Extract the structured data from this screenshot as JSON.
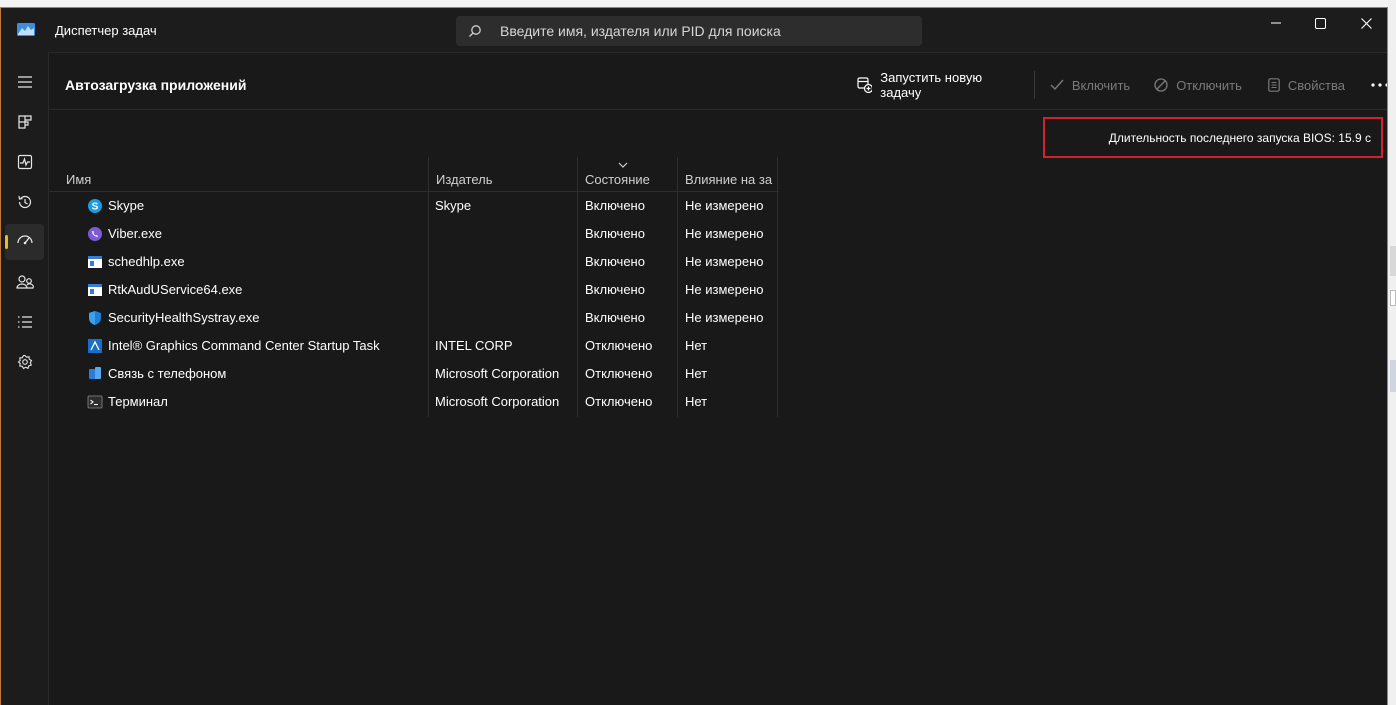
{
  "window": {
    "title": "Диспетчер задач",
    "search_placeholder": "Введите имя, издателя или PID для поиска"
  },
  "sidebar": {
    "items": [
      {
        "icon": "hamburger-menu-icon"
      },
      {
        "icon": "processes-icon"
      },
      {
        "icon": "performance-icon"
      },
      {
        "icon": "app-history-icon"
      },
      {
        "icon": "startup-apps-icon",
        "active": true
      },
      {
        "icon": "users-icon"
      },
      {
        "icon": "details-icon"
      },
      {
        "icon": "services-icon"
      }
    ]
  },
  "header": {
    "title": "Автозагрузка приложений",
    "run_task": "Запустить новую задачу",
    "enable": "Включить",
    "disable": "Отключить",
    "properties": "Свойства"
  },
  "bios": {
    "text": "Длительность последнего запуска BIOS: 15.9 с"
  },
  "table": {
    "columns": {
      "name": "Имя",
      "publisher": "Издатель",
      "status": "Состояние",
      "impact": "Влияние на за"
    },
    "rows": [
      {
        "name": "Skype",
        "publisher": "Skype",
        "status": "Включено",
        "impact": "Не измерено",
        "icon": "skype-icon"
      },
      {
        "name": "Viber.exe",
        "publisher": "",
        "status": "Включено",
        "impact": "Не измерено",
        "icon": "viber-icon"
      },
      {
        "name": "schedhlp.exe",
        "publisher": "",
        "status": "Включено",
        "impact": "Не измерено",
        "icon": "app-window-icon"
      },
      {
        "name": "RtkAudUService64.exe",
        "publisher": "",
        "status": "Включено",
        "impact": "Не измерено",
        "icon": "app-window-icon"
      },
      {
        "name": "SecurityHealthSystray.exe",
        "publisher": "",
        "status": "Включено",
        "impact": "Не измерено",
        "icon": "security-shield-icon"
      },
      {
        "name": "Intel® Graphics Command Center Startup Task",
        "publisher": "INTEL CORP",
        "status": "Отключено",
        "impact": "Нет",
        "icon": "intel-graphics-icon"
      },
      {
        "name": "Связь с телефоном",
        "publisher": "Microsoft Corporation",
        "status": "Отключено",
        "impact": "Нет",
        "icon": "phone-link-icon"
      },
      {
        "name": "Терминал",
        "publisher": "Microsoft Corporation",
        "status": "Отключено",
        "impact": "Нет",
        "icon": "terminal-icon"
      }
    ]
  }
}
